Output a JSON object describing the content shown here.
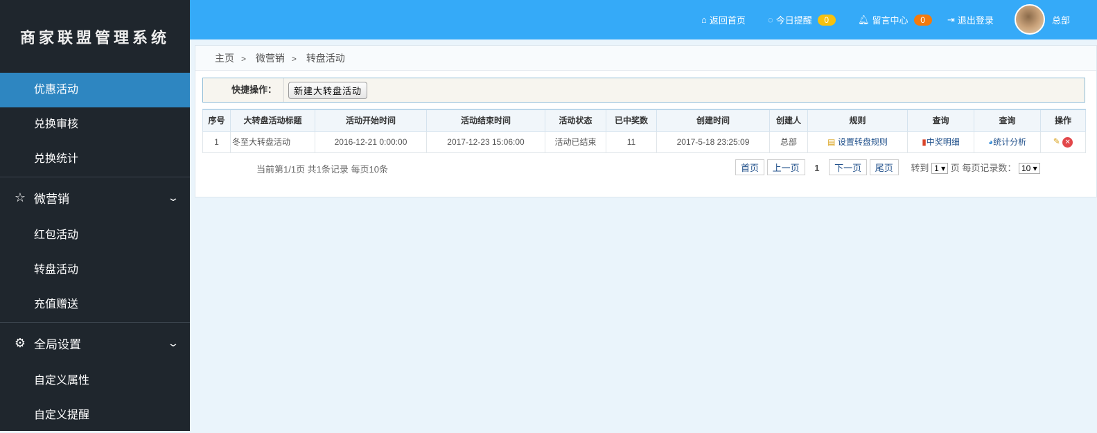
{
  "app_title": "商家联盟管理系统",
  "sidebar": {
    "items_top": [
      {
        "label": "优惠活动",
        "active": true
      },
      {
        "label": "兑换审核"
      },
      {
        "label": "兑换统计"
      }
    ],
    "groups": [
      {
        "label": "微营销",
        "icon": "star-icon",
        "items": [
          {
            "label": "红包活动"
          },
          {
            "label": "转盘活动"
          },
          {
            "label": "充值赠送"
          }
        ]
      },
      {
        "label": "全局设置",
        "icon": "gear-icon",
        "items": [
          {
            "label": "自定义属性"
          },
          {
            "label": "自定义提醒"
          }
        ]
      }
    ]
  },
  "header": {
    "home": "返回首页",
    "reminders": "今日提醒",
    "reminders_count": "0",
    "messages": "留言中心",
    "messages_count": "0",
    "logout": "退出登录",
    "user": "总部",
    "colors": {
      "bar": "#35aaf8",
      "badge_yellow": "#f6c10e",
      "badge_orange": "#f47a0c"
    }
  },
  "breadcrumb": [
    "主页",
    "微营销",
    "转盘活动"
  ],
  "quick": {
    "label": "快捷操作：",
    "new_button": "新建大转盘活动"
  },
  "table": {
    "headers": [
      "序号",
      "大转盘活动标题",
      "活动开始时间",
      "活动结束时间",
      "活动状态",
      "已中奖数",
      "创建时间",
      "创建人",
      "规则",
      "查询",
      "查询",
      "操作"
    ],
    "rows": [
      {
        "no": "1",
        "title": "冬至大转盘活动",
        "start": "2016-12-21 0:00:00",
        "end": "2017-12-23 15:06:00",
        "status": "活动已结束",
        "winners": "11",
        "created": "2017-5-18 23:25:09",
        "creator": "总部",
        "rule": "设置转盘规则",
        "query1": "中奖明细",
        "query2": "统计分析"
      }
    ]
  },
  "pagination": {
    "summary": "当前第1/1页 共1条记录 每页10条",
    "first": "首页",
    "prev": "上一页",
    "current": "1",
    "next": "下一页",
    "last": "尾页",
    "goto": "转到",
    "goto_value": "1 ▾",
    "page_unit": "页",
    "per_page_label": "每页记录数：",
    "per_page_value": "10 ▾"
  }
}
